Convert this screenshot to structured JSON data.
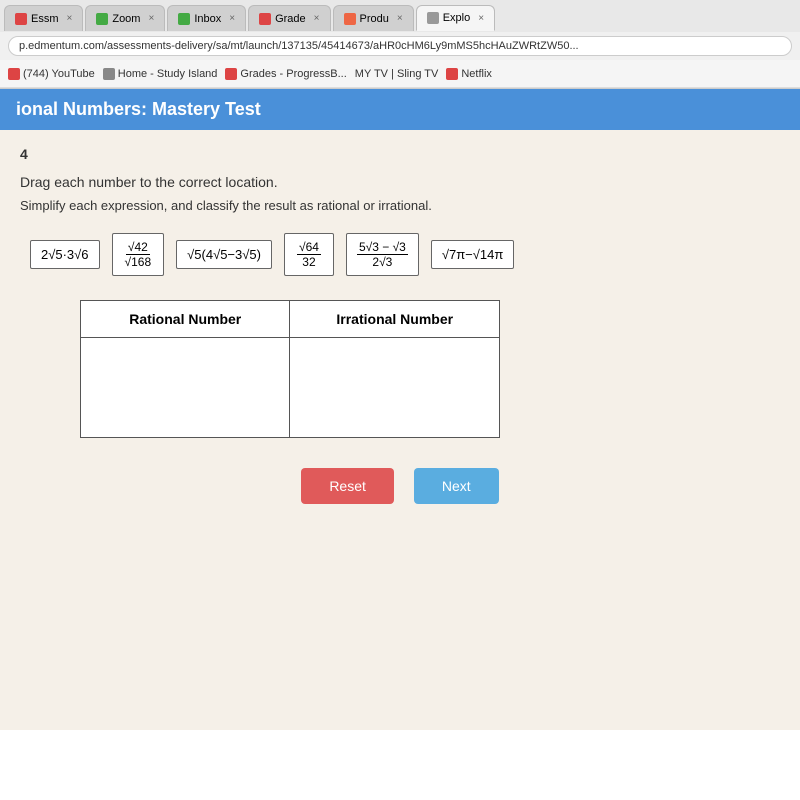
{
  "browser": {
    "tabs": [
      {
        "label": "Essm",
        "color": "#d44",
        "active": false
      },
      {
        "label": "Zoom",
        "color": "#4a4",
        "active": false
      },
      {
        "label": "Inbox",
        "color": "#4a4",
        "active": false
      },
      {
        "label": "Grade",
        "color": "#d44",
        "active": false
      },
      {
        "label": "Produ",
        "color": "#e64",
        "active": false
      },
      {
        "label": "Explo",
        "color": "#999",
        "active": true
      }
    ],
    "address": "p.edmentum.com/assessments-delivery/sa/mt/launch/137135/45414673/aHR0cHM6Ly9mMS5hcHAuZWRtZW50...",
    "bookmarks": [
      {
        "label": "(744) YouTube",
        "color": "#d44"
      },
      {
        "label": "Home - Study Island",
        "color": "#888"
      },
      {
        "label": "Grades - ProgressB...",
        "color": "#d44"
      },
      {
        "label": "MY TV | Sling TV",
        "color": "#888"
      },
      {
        "label": "Netflix",
        "color": "#d44"
      }
    ]
  },
  "page": {
    "title": "ional Numbers: Mastery Test",
    "question_number": "4",
    "instruction1": "Drag each number to the correct location.",
    "instruction2": "Simplify each expression, and classify the result as rational or irrational.",
    "expressions": [
      {
        "id": "expr1",
        "display": "2√5·3√6"
      },
      {
        "id": "expr2",
        "display": "√42/√168"
      },
      {
        "id": "expr3",
        "display": "√5(4√5−3√5)"
      },
      {
        "id": "expr4",
        "display": "√64/32"
      },
      {
        "id": "expr5",
        "display": "5√3−√3/2√3"
      },
      {
        "id": "expr6",
        "display": "√7π−√14π"
      }
    ],
    "table": {
      "col1_header": "Rational Number",
      "col2_header": "Irrational Number"
    },
    "buttons": {
      "reset": "Reset",
      "next": "Next"
    }
  }
}
